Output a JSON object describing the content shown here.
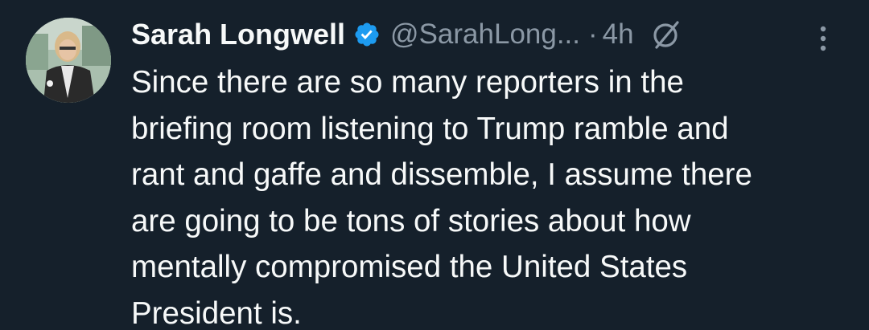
{
  "tweet": {
    "author_name": "Sarah Longwell",
    "handle": "@SarahLong...",
    "separator": "·",
    "time": "4h",
    "text_lines": [
      "Since there are so many reporters in the",
      "briefing room listening to Trump ramble and",
      "rant and gaffe and dissemble, I assume there",
      "are going to be tons of stories about how",
      "mentally compromised the United States",
      "President is."
    ]
  },
  "icons": {
    "verified": "verified-badge-icon",
    "grok": "grok-icon",
    "more": "more-options-icon"
  },
  "colors": {
    "background": "#15202b",
    "primary_text": "#f7f9f9",
    "secondary_text": "#8b98a5",
    "verified_blue": "#1d9bf0"
  }
}
